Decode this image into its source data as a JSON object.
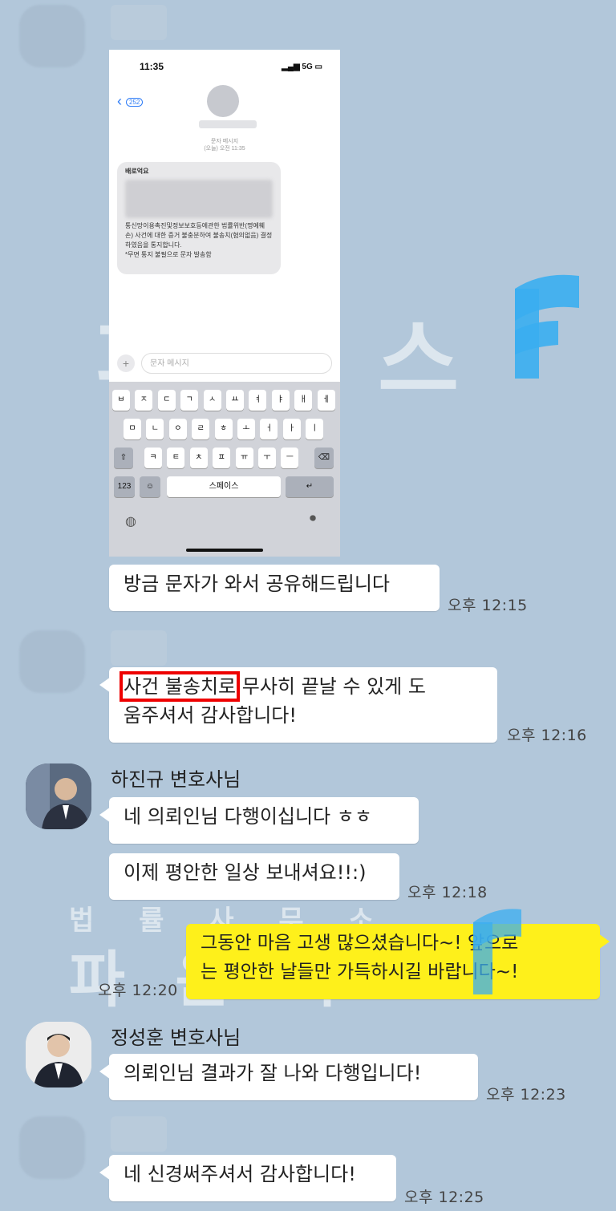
{
  "phone_screenshot": {
    "time": "11:35",
    "signal": "5G",
    "back_badge": "252",
    "meta_line1": "문자 메시지",
    "meta_line2": "(오늘) 오전 11:35",
    "sms_greeting": "배로억요",
    "sms_body": "통신망이용촉진및정보보호등에관한 법률위반(명예훼손) 사건에 대한 증거 불충분하여 불송치(혐의없음) 결정 하였음을 통지합니다.",
    "sms_footer": "*무면 통지 불필으로 문자 발송함",
    "input_placeholder": "문자 메시지",
    "keyboard_row1": [
      "ㅂ",
      "ㅈ",
      "ㄷ",
      "ㄱ",
      "ㅅ",
      "ㅛ",
      "ㅕ",
      "ㅑ",
      "ㅐ",
      "ㅔ"
    ],
    "keyboard_row2": [
      "ㅁ",
      "ㄴ",
      "ㅇ",
      "ㄹ",
      "ㅎ",
      "ㅗ",
      "ㅓ",
      "ㅏ",
      "ㅣ"
    ],
    "keyboard_row3": [
      "ㅋ",
      "ㅌ",
      "ㅊ",
      "ㅍ",
      "ㅠ",
      "ㅜ",
      "ㅡ"
    ],
    "key_numbers": "123",
    "key_space": "스페이스"
  },
  "messages": {
    "m1": {
      "text": "방금 문자가 와서 공유해드립니다",
      "time": "오후 12:15"
    },
    "m2": {
      "highlight": "사건 불송치로",
      "text_line1_rest": " 무사히 끝날 수 있게 도",
      "text_line2": "움주셔서 감사합니다!",
      "time": "오후 12:16"
    },
    "m3": {
      "sender": "하진규 변호사님",
      "text": "네 의뢰인님 다행이십니다 ㅎㅎ"
    },
    "m4": {
      "text": "이제 평안한 일상 보내셔요!!:)",
      "time": "오후 12:18"
    },
    "m5": {
      "line1": "그동안 마음 고생 많으셨습니다~! 앞으로",
      "line2": "는 평안한 날들만 가득하시길 바랍니다~!",
      "time": "오후 12:20"
    },
    "m6": {
      "sender": "정성훈 변호사님",
      "text": "의뢰인님 결과가 잘 나와 다행입니다!",
      "time": "오후 12:23"
    },
    "m7": {
      "text": "네 신경써주셔서 감사합니다!",
      "time": "오후 12:25"
    }
  },
  "watermark": {
    "top_text": "파 더 스",
    "bottom_small": "법 률 사 무 소",
    "bottom_big": "파 운 더 스"
  },
  "colors": {
    "chat_bg": "#b2c7da",
    "my_bubble": "#fef01b",
    "highlight_border": "#ee0000",
    "brand_blue": "#3aaef0"
  }
}
